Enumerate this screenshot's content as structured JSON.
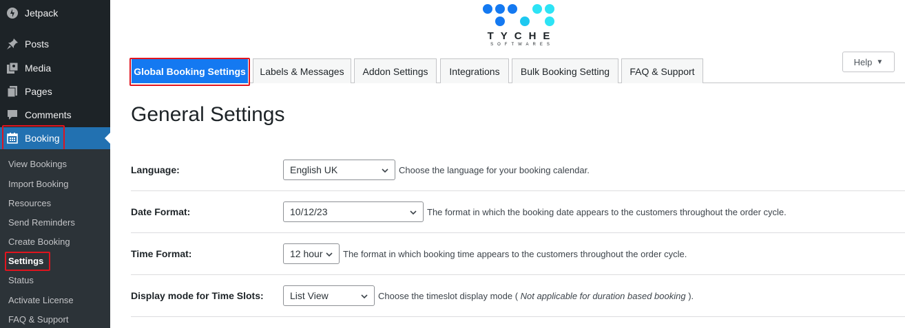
{
  "sidebar": {
    "items": [
      {
        "label": "Jetpack",
        "icon": "jetpack-icon"
      },
      {
        "label": "Posts",
        "icon": "pin-icon"
      },
      {
        "label": "Media",
        "icon": "media-icon"
      },
      {
        "label": "Pages",
        "icon": "pages-icon"
      },
      {
        "label": "Comments",
        "icon": "comment-icon"
      },
      {
        "label": "Booking",
        "icon": "calendar-icon"
      }
    ],
    "submenu": [
      "View Bookings",
      "Import Booking",
      "Resources",
      "Send Reminders",
      "Create Booking",
      "Settings",
      "Status",
      "Activate License",
      "FAQ & Support"
    ]
  },
  "logo": {
    "name": "TYCHE",
    "sub": "SOFTWARES",
    "colors": [
      "#1479f1",
      "#1ec8f0",
      "#2de3f5"
    ]
  },
  "tabs": [
    "Global Booking Settings",
    "Labels & Messages",
    "Addon Settings",
    "Integrations",
    "Bulk Booking Setting",
    "FAQ & Support"
  ],
  "help": {
    "label": "Help"
  },
  "page_title": "General Settings",
  "settings": [
    {
      "label": "Language:",
      "value": "English UK",
      "desc": "Choose the language for your booking calendar."
    },
    {
      "label": "Date Format:",
      "value": "10/12/23",
      "desc": "The format in which the booking date appears to the customers throughout the order cycle."
    },
    {
      "label": "Time Format:",
      "value": "12 hour",
      "desc": "The format in which booking time appears to the customers throughout the order cycle."
    },
    {
      "label": "Display mode for Time Slots:",
      "value": "List View",
      "desc_prefix": "Choose the timeslot display mode ( ",
      "desc_italic": "Not applicable for duration based booking",
      "desc_suffix": " )."
    }
  ],
  "colors": {
    "sidebar_bg": "#1d2327",
    "accent": "#2271b1",
    "active_tab": "#1479f1",
    "highlight": "#e0141e"
  }
}
